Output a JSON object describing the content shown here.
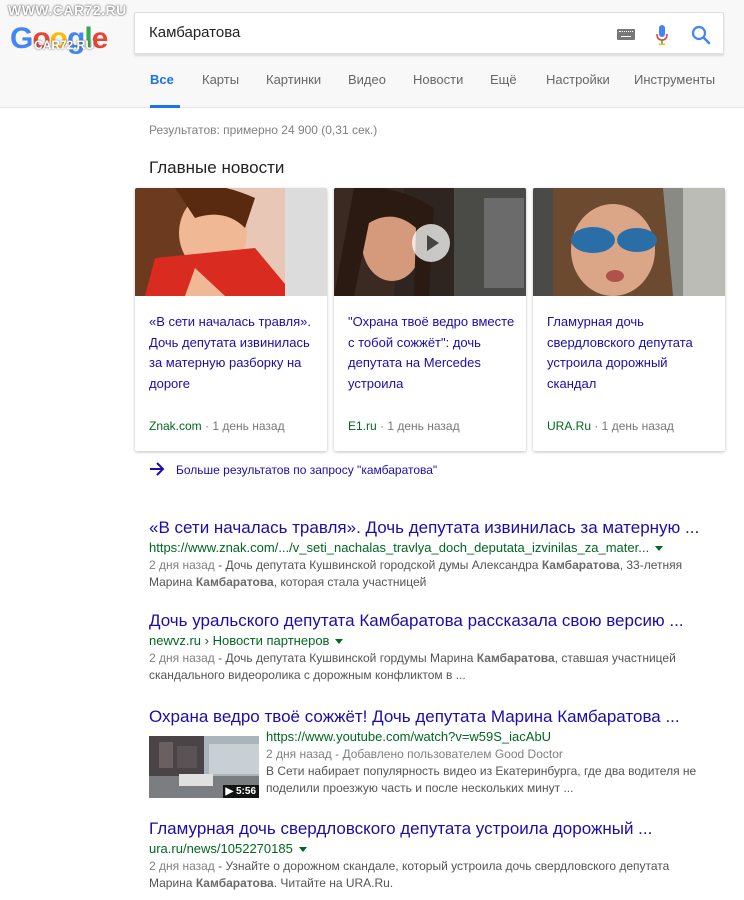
{
  "watermark": {
    "line1": "WWW.CAR72.RU",
    "line2": "CAR72.RU"
  },
  "logo": {
    "letters": [
      "G",
      "o",
      "o",
      "g",
      "l",
      "e"
    ]
  },
  "search": {
    "query": "Камбаратова"
  },
  "icons": {
    "keyboard": "keyboard-icon",
    "mic": "mic-icon",
    "search": "search-icon"
  },
  "tabs": [
    {
      "label": "Все",
      "active": true
    },
    {
      "label": "Карты"
    },
    {
      "label": "Картинки"
    },
    {
      "label": "Видео"
    },
    {
      "label": "Новости"
    },
    {
      "label": "Ещё"
    },
    {
      "label": "Настройки"
    },
    {
      "label": "Инструменты"
    }
  ],
  "stats": "Результатов: примерно 24 900 (0,31 сек.)",
  "top_news": {
    "title": "Главные новости",
    "cards": [
      {
        "title": "«В сети началась травля». Дочь депутата извинилась за матерную разборку на дороге",
        "source": "Znak.com",
        "time": " · 1 день назад"
      },
      {
        "title": "\"Охрана твоё ведро вместе с тобой сожжёт\": дочь депутата на Mercedes устроила",
        "source": "E1.ru",
        "time": " · 1 день назад",
        "video": true
      },
      {
        "title": "Гламурная дочь свердловского депутата устроила дорожный скандал",
        "source": "URA.Ru",
        "time": " · 1 день назад"
      }
    ],
    "more": "Больше результатов по запросу \"камбаратова\""
  },
  "results": [
    {
      "title": "«В сети началась травля». Дочь депутата извинилась за матерную ...",
      "url": "https://www.znak.com/.../v_seti_nachalas_travlya_doch_deputata_izvinilas_za_mater...",
      "date": "2 дня назад",
      "snippet_a": " - Дочь депутата Кушвинской городской думы Александра ",
      "bold1": "Камбаратова",
      "snippet_b": ", 33-летняя",
      "snippet_c": "Марина ",
      "bold2": "Камбаратова",
      "snippet_d": ", которая стала участницей"
    },
    {
      "title": "Дочь уральского депутата Камбаратова рассказала свою версию ...",
      "url": "newvz.ru › Новости партнеров",
      "date": "2 дня назад",
      "snippet_a": " - Дочь депутата Кушвинской гордумы Марина ",
      "bold1": "Камбаратова",
      "snippet_b": ", ставшая участницей",
      "snippet_c": "скандального видеоролика с дорожным конфликтом в ..."
    },
    {
      "title": "Охрана ведро твоё сожжёт! Дочь депутата Марина Камбаратова ...",
      "url": "https://www.youtube.com/watch?v=w59S_iacAbU",
      "date": "2 дня назад",
      "uploader": " - Добавлено пользователем Good Doctor",
      "snippet_a": "В Сети набирает популярность видео из Екатеринбурга, где два водителя не",
      "snippet_b": "поделили проезжую часть и после нескольких минут ...",
      "duration": "▶ 5:56"
    },
    {
      "title": "Гламурная дочь свердловского депутата устроила дорожный ...",
      "url": "ura.ru/news/1052270185",
      "date": "2 дня назад",
      "snippet_a": " - Узнайте о дорожном скандале, который устроила дочь свердловского депутата",
      "snippet_c": "Марина ",
      "bold2": "Камбаратова",
      "snippet_d": ". Читайте на URA.Ru."
    }
  ],
  "colors": {
    "link": "#1a0dab",
    "url": "#006621",
    "accent": "#1a73e8"
  }
}
